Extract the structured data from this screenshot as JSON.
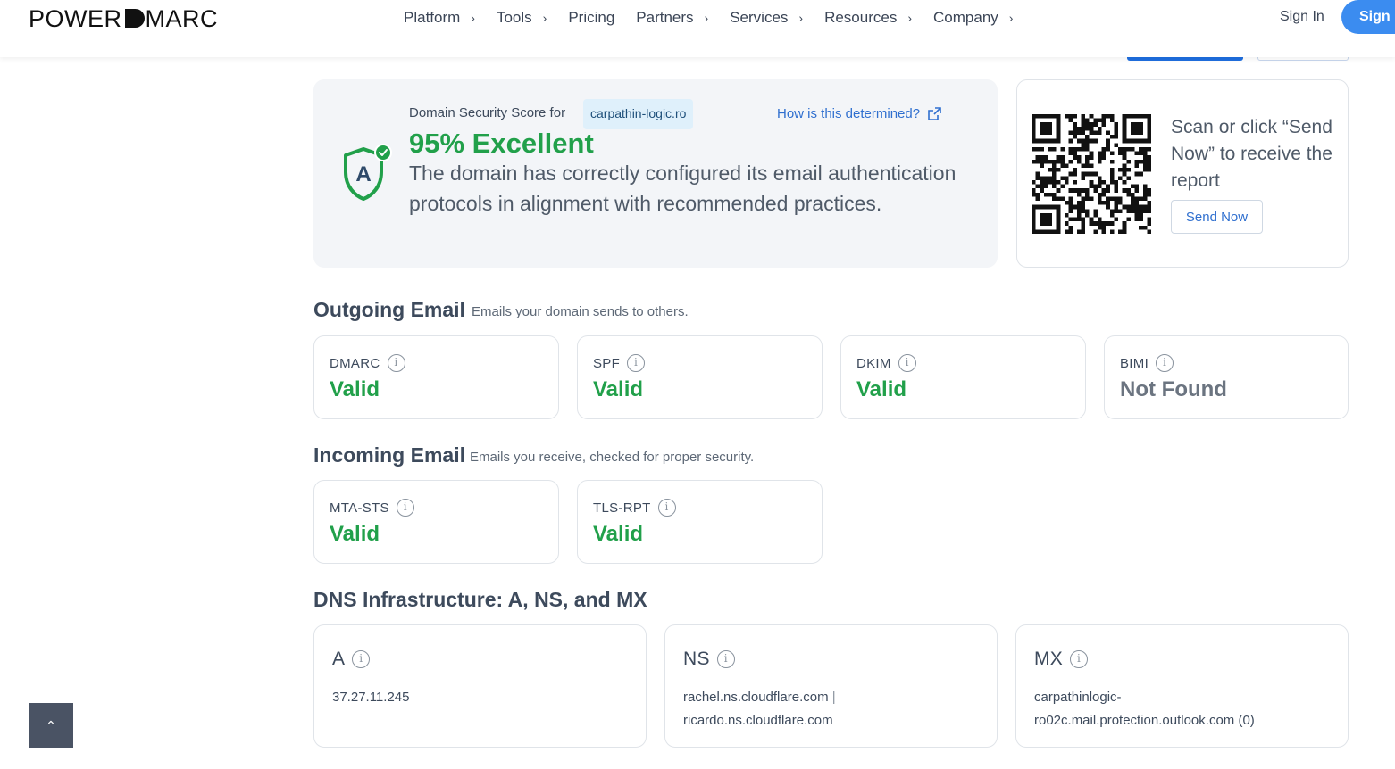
{
  "header": {
    "logo_left": "POWER",
    "logo_right": "DMARC",
    "nav": [
      {
        "label": "Platform",
        "chevron": true
      },
      {
        "label": "Tools",
        "chevron": true
      },
      {
        "label": "Pricing",
        "chevron": false
      },
      {
        "label": "Partners",
        "chevron": true
      },
      {
        "label": "Services",
        "chevron": true
      },
      {
        "label": "Resources",
        "chevron": true
      },
      {
        "label": "Company",
        "chevron": true
      }
    ],
    "signin": "Sign In",
    "signup": "Sign"
  },
  "score": {
    "label": "Domain Security Score for",
    "domain": "carpathin-logic.ro",
    "how_link": "How is this determined?",
    "title": "95% Excellent",
    "description": "The domain has correctly configured its email authentication protocols in alignment with recommended practices.",
    "grade": "A"
  },
  "qr_card": {
    "text": "Scan or click “Send Now” to receive the report",
    "button": "Send Now"
  },
  "outgoing": {
    "title": "Outgoing Email",
    "subtitle": "Emails your domain sends to others.",
    "cards": [
      {
        "name": "DMARC",
        "status": "Valid"
      },
      {
        "name": "SPF",
        "status": "Valid"
      },
      {
        "name": "DKIM",
        "status": "Valid"
      },
      {
        "name": "BIMI",
        "status": "Not Found"
      }
    ]
  },
  "incoming": {
    "title": "Incoming Email",
    "subtitle": "Emails you receive, checked for proper security.",
    "cards": [
      {
        "name": "MTA-STS",
        "status": "Valid"
      },
      {
        "name": "TLS-RPT",
        "status": "Valid"
      }
    ]
  },
  "dns": {
    "title": "DNS Infrastructure: A, NS, and MX",
    "cards": [
      {
        "name": "A",
        "line1": "37.27.11.245",
        "line2": ""
      },
      {
        "name": "NS",
        "line1": "rachel.ns.cloudflare.com",
        "separator": "|",
        "line2": "ricardo.ns.cloudflare.com"
      },
      {
        "name": "MX",
        "line1": "carpathinlogic-",
        "line2": "ro02c.mail.protection.outlook.com (0)"
      }
    ]
  },
  "colors": {
    "valid": "#21a04a",
    "link": "#2f6fcf",
    "accent": "#3b8cf0"
  }
}
